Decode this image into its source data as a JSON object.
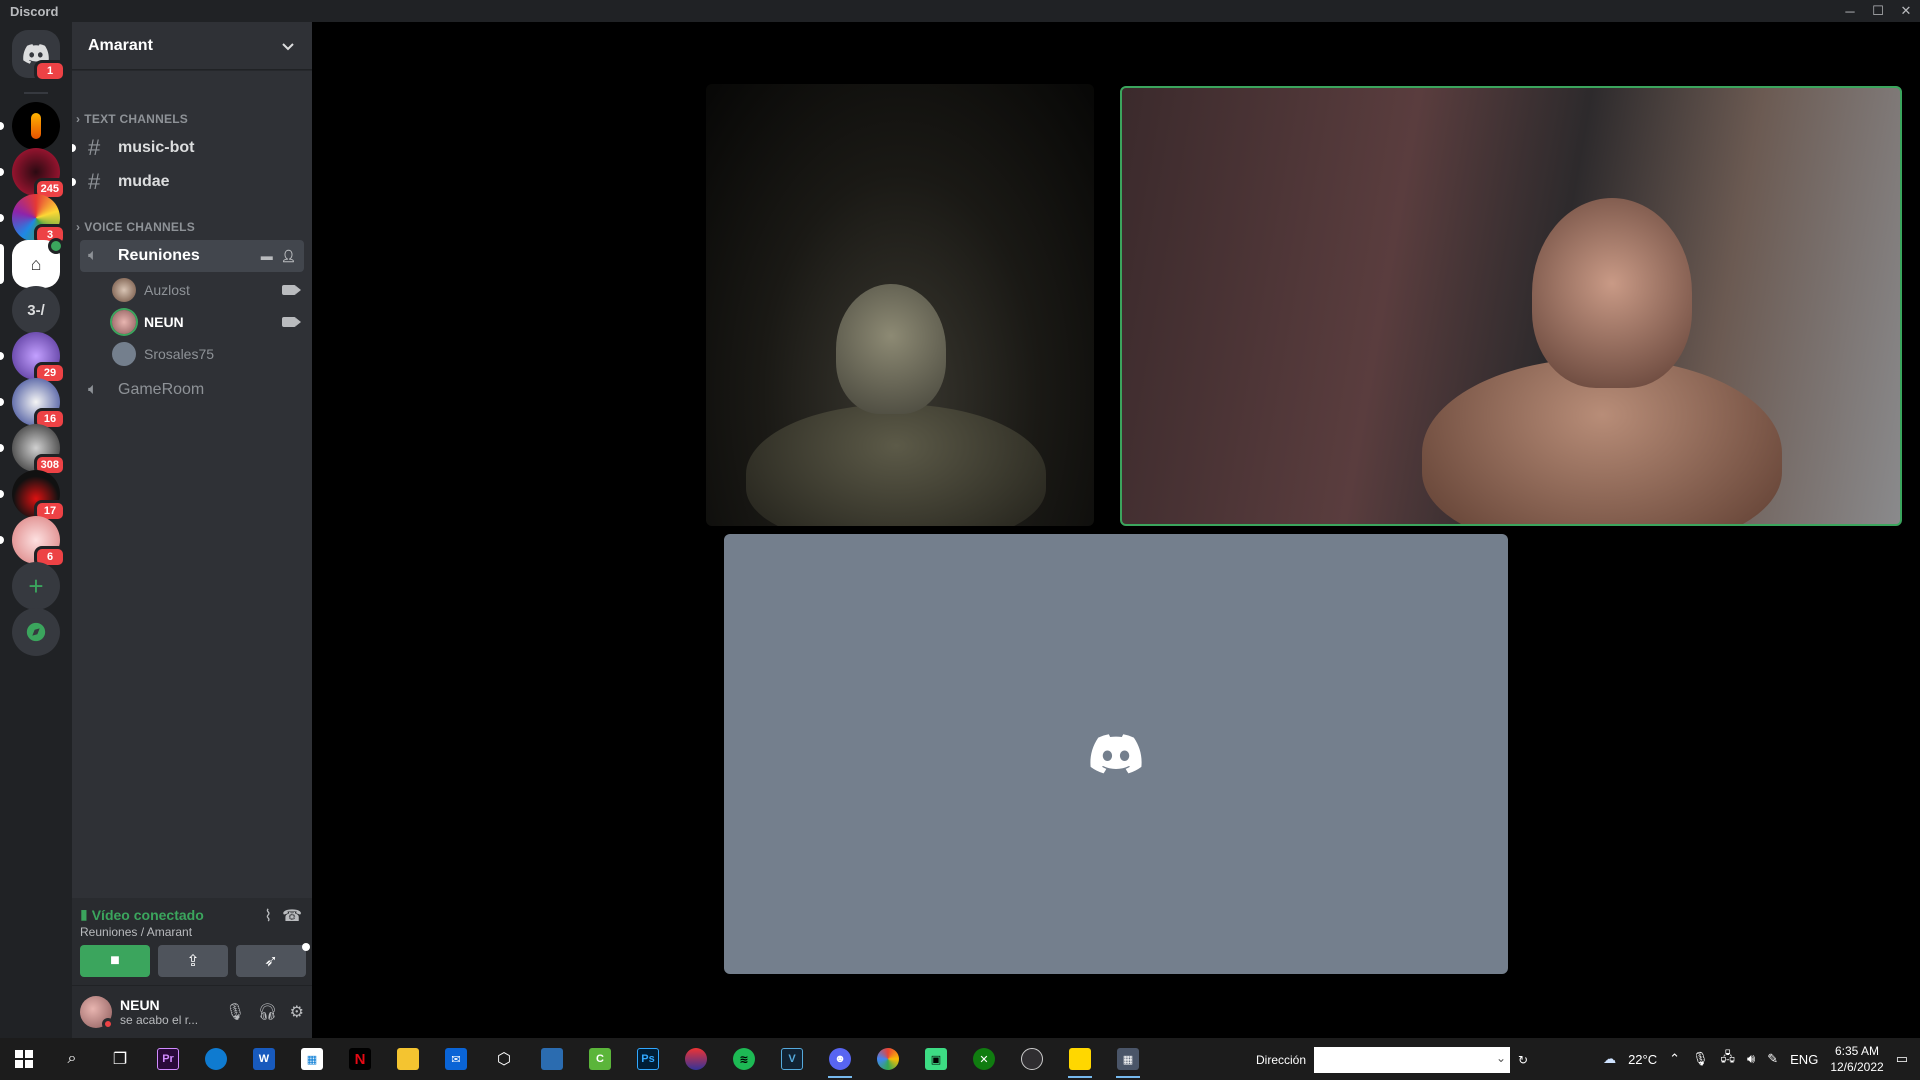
{
  "window": {
    "title": "Discord",
    "controls": [
      "─",
      "☐",
      "✕"
    ]
  },
  "servers": [
    {
      "name": "home",
      "badge": "1",
      "color": "#5865f2"
    },
    {
      "name": "server-2",
      "badge": "",
      "color": "#000000"
    },
    {
      "name": "server-3",
      "badge": "245",
      "color": "#c0183a"
    },
    {
      "name": "server-4",
      "badge": "3",
      "color": "#1e88e5"
    },
    {
      "name": "server-5-active",
      "badge": "",
      "color": "#ffffff"
    },
    {
      "name": "server-6",
      "label": "3-/",
      "badge": "",
      "color": "#36393f"
    },
    {
      "name": "server-7",
      "badge": "29",
      "color": "#7a5cc2"
    },
    {
      "name": "server-8",
      "badge": "16",
      "color": "#2a3b8f"
    },
    {
      "name": "server-9",
      "badge": "308",
      "color": "#444444"
    },
    {
      "name": "server-10",
      "badge": "17",
      "color": "#a01818"
    },
    {
      "name": "server-11",
      "badge": "6",
      "color": "#e8b0b0"
    }
  ],
  "guild": {
    "name": "Amarant"
  },
  "categories": {
    "text": "TEXT CHANNELS",
    "voice": "VOICE CHANNELS"
  },
  "text_channels": [
    {
      "name": "music-bot"
    },
    {
      "name": "mudae"
    }
  ],
  "voice_channels": [
    {
      "name": "Reuniones"
    },
    {
      "name": "GameRoom"
    }
  ],
  "voice_members": [
    {
      "name": "Auzlost",
      "video": true
    },
    {
      "name": "NEUN",
      "video": true
    },
    {
      "name": "Srosales75",
      "video": false
    }
  ],
  "voice_panel": {
    "status": "Vídeo conectado",
    "location": "Reuniones / Amarant"
  },
  "user": {
    "name": "NEUN",
    "status": "se acabo el r..."
  },
  "taskbar": {
    "apps": [
      "windows",
      "search",
      "task-view",
      "premiere",
      "edge",
      "word",
      "store",
      "netflix",
      "explorer",
      "mail",
      "unity",
      "app-9",
      "camtasia",
      "photoshop",
      "app-13",
      "spotify",
      "vegas",
      "discord",
      "chrome",
      "app-18",
      "xbox",
      "obs",
      "sticky-notes",
      "calculator"
    ],
    "address_label": "Dirección",
    "temperature": "22°C",
    "language": "ENG",
    "time": "6:35 AM",
    "date": "12/6/2022"
  }
}
